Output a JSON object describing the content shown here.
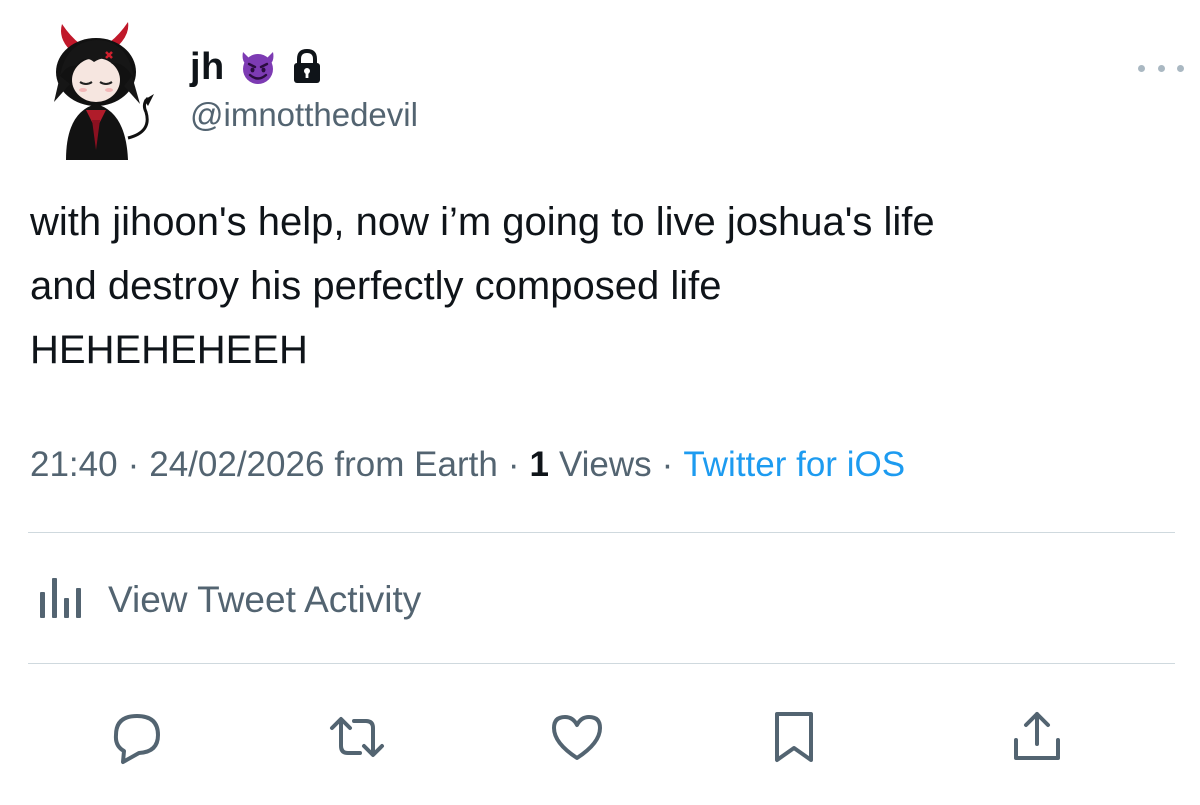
{
  "tweet": {
    "display_name": "jh",
    "handle": "@imnotthedevil",
    "text_lines": [
      "with jihoon's help, now i’m going to live joshua's life",
      "and destroy his perfectly composed life",
      "HEHEHEHEEH"
    ],
    "time": "21:40",
    "date": "24/02/2026",
    "location": "from Earth",
    "views_count": "1",
    "views_label": "Views",
    "source": "Twitter for iOS",
    "separator": "·"
  },
  "activity": {
    "label": "View Tweet Activity"
  },
  "icons": {
    "name_emoji": "smiling-devil-emoji",
    "protected": "lock-icon",
    "more": "more-options-icon",
    "activity": "bar-chart-icon",
    "actions": [
      "reply-icon",
      "retweet-icon",
      "like-icon",
      "bookmark-icon",
      "share-icon"
    ]
  },
  "colors": {
    "text": "#0f1419",
    "secondary": "#536471",
    "link": "#1d9bf0",
    "divider": "#cfd9de",
    "emoji_purple": "#7d3bb3"
  }
}
